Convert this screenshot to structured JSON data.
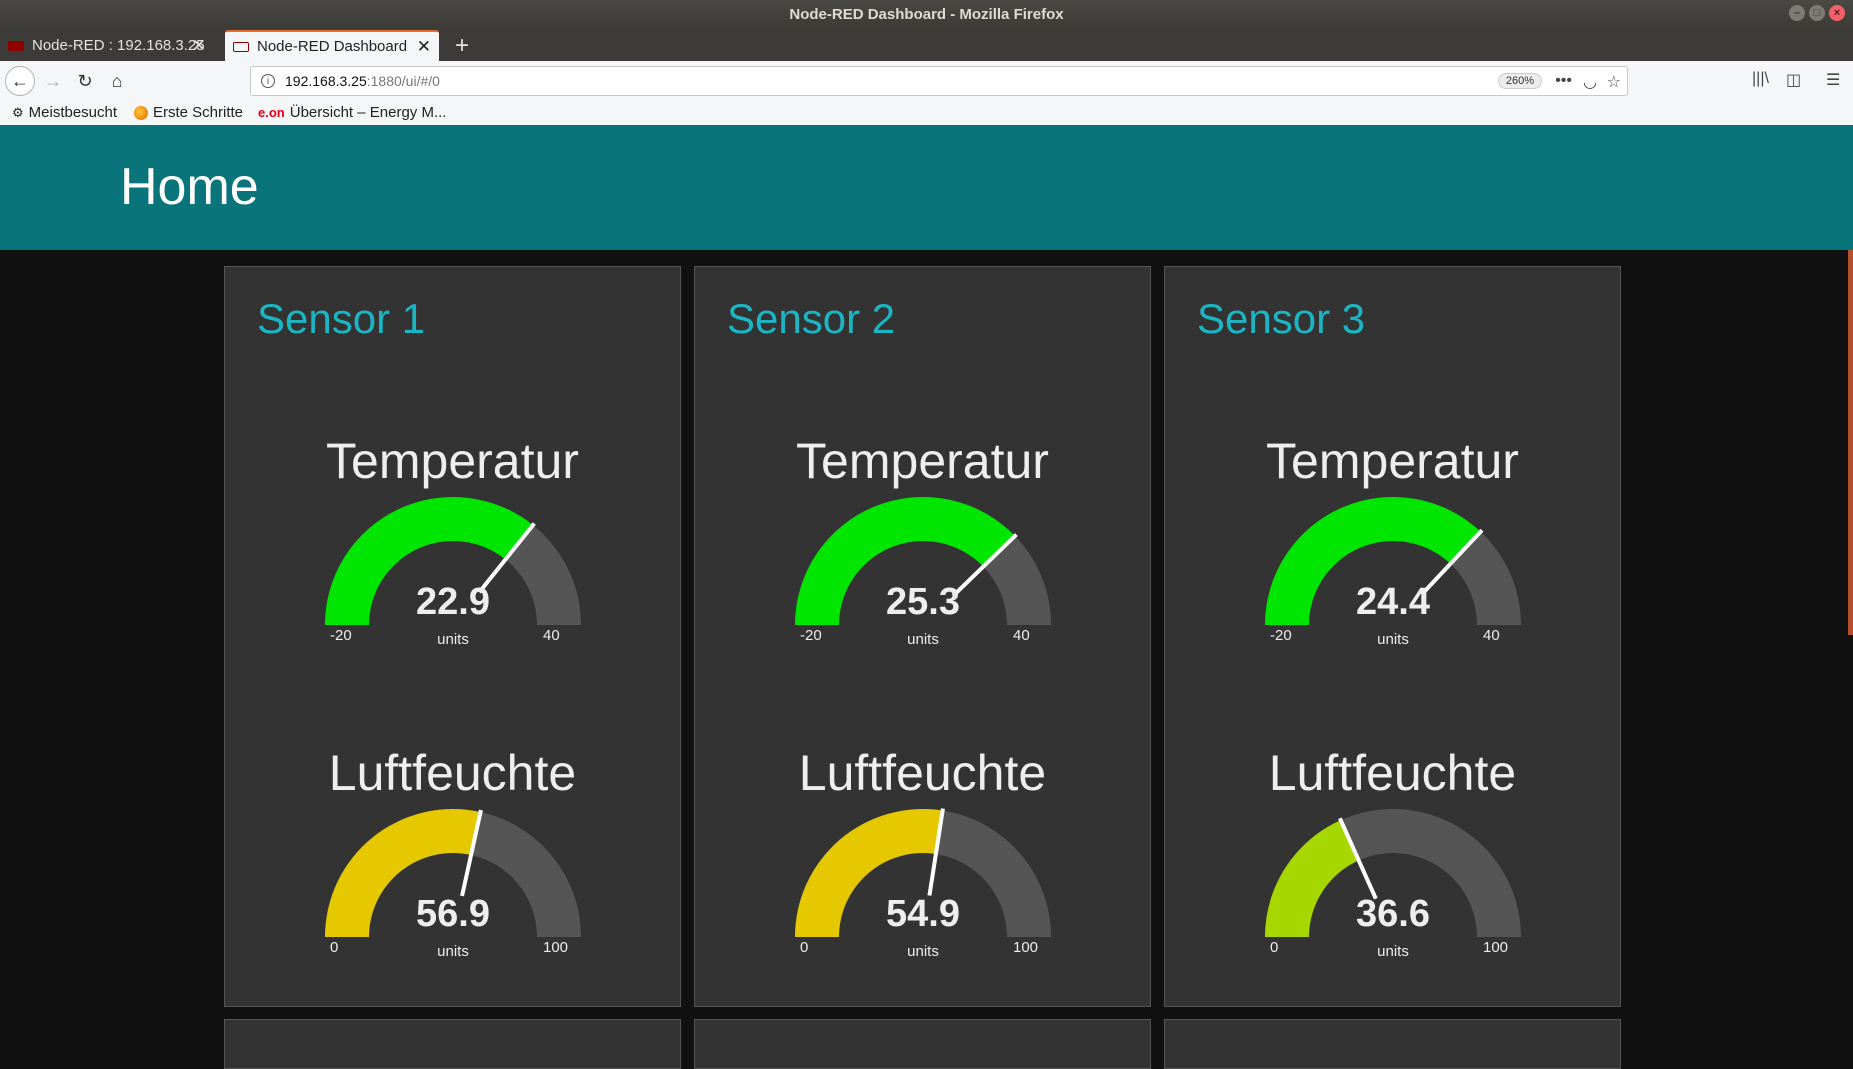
{
  "window": {
    "title": "Node-RED Dashboard - Mozilla Firefox"
  },
  "tabs": [
    {
      "label": "Node-RED : 192.168.3.25",
      "active": false
    },
    {
      "label": "Node-RED Dashboard",
      "active": true
    }
  ],
  "navbar": {
    "url_host": "192.168.3.25",
    "url_path": ":1880/ui/#/0",
    "zoom": "260%"
  },
  "bookmarks": [
    {
      "label": "Meistbesucht",
      "icon": "gear-icon"
    },
    {
      "label": "Erste Schritte",
      "icon": "firefox-icon"
    },
    {
      "label": "Übersicht – Energy M...",
      "icon": "eon-icon"
    }
  ],
  "dashboard": {
    "title": "Home",
    "header_color": "#097479",
    "accent_color": "#1bb5c4"
  },
  "sensors": [
    {
      "title": "Sensor 1",
      "temperature": {
        "label": "Temperatur",
        "value": "22.9",
        "units": "units",
        "min": "-20",
        "max": "40",
        "color": "#00e600"
      },
      "humidity": {
        "label": "Luftfeuchte",
        "value": "56.9",
        "units": "units",
        "min": "0",
        "max": "100",
        "color": "#e6c800"
      }
    },
    {
      "title": "Sensor 2",
      "temperature": {
        "label": "Temperatur",
        "value": "25.3",
        "units": "units",
        "min": "-20",
        "max": "40",
        "color": "#00e600"
      },
      "humidity": {
        "label": "Luftfeuchte",
        "value": "54.9",
        "units": "units",
        "min": "0",
        "max": "100",
        "color": "#e6c800"
      }
    },
    {
      "title": "Sensor 3",
      "temperature": {
        "label": "Temperatur",
        "value": "24.4",
        "units": "units",
        "min": "-20",
        "max": "40",
        "color": "#00e600"
      },
      "humidity": {
        "label": "Luftfeuchte",
        "value": "36.6",
        "units": "units",
        "min": "0",
        "max": "100",
        "color": "#a6d800"
      }
    }
  ]
}
